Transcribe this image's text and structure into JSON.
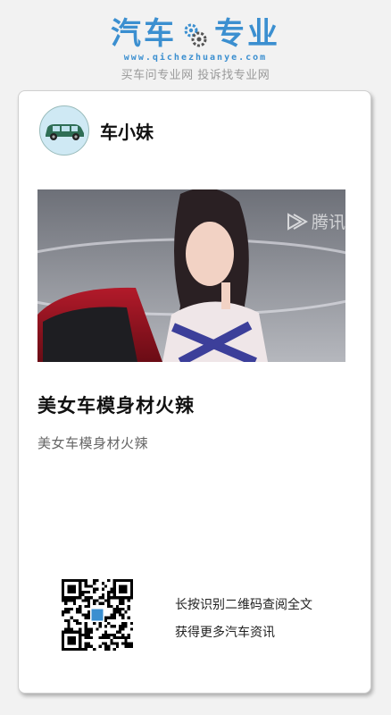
{
  "brand": {
    "title_left": "汽车",
    "title_right": "专业",
    "domain": "www.qichezhuanye.com",
    "slogan": "买车问专业网 投诉找专业网",
    "logo_icon": "gear-icon"
  },
  "author": {
    "name": "车小妹",
    "avatar_icon": "car-icon"
  },
  "media": {
    "watermark_text": "腾讯",
    "watermark_icon": "play-icon"
  },
  "article": {
    "title": "美女车模身材火辣",
    "summary": "美女车模身材火辣"
  },
  "qr": {
    "line1": "长按识别二维码查阅全文",
    "line2": "获得更多汽车资讯"
  },
  "colors": {
    "brand": "#3b8fd0",
    "background": "#f2f2f2",
    "card": "#ffffff"
  }
}
